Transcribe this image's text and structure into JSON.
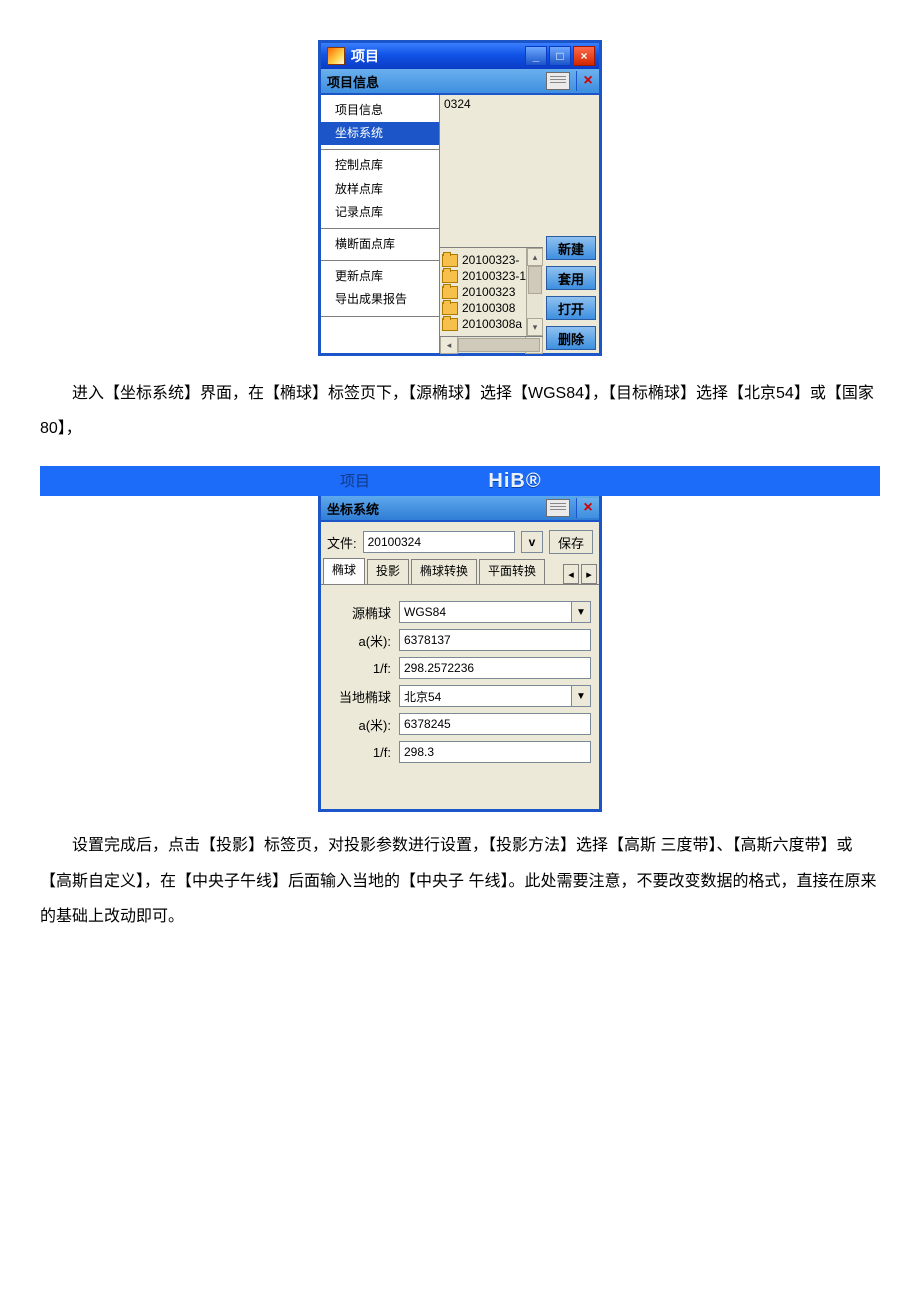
{
  "win1": {
    "title": "项目",
    "subheader": "项目信息",
    "menu": {
      "g1": [
        "项目信息",
        "坐标系统"
      ],
      "g2": [
        "控制点库",
        "放样点库",
        "记录点库"
      ],
      "g3": [
        "横断面点库"
      ],
      "g4": [
        "更新点库",
        "导出成果报告"
      ]
    },
    "top_right_text": "0324",
    "folders": [
      "20100323-",
      "20100323-1",
      "20100323",
      "20100308",
      "20100308a"
    ],
    "buttons": {
      "new": "新建",
      "apply": "套用",
      "open": "打开",
      "del": "删除"
    },
    "wbtn": {
      "min": "_",
      "max": "□",
      "close": "×"
    }
  },
  "para1": "进入【坐标系统】界面，在【椭球】标签页下，【源椭球】选择【WGS84】，【目标椭球】选择【北京54】或【国家80】，",
  "win2": {
    "bar_title": "项目",
    "brand": "HiB®",
    "subheader": "坐标系统",
    "file_label": "文件:",
    "file_value": "20100324",
    "save": "保存",
    "tabs": {
      "t1": "椭球",
      "t2": "投影",
      "t3": "椭球转换",
      "t4": "平面转换"
    },
    "fields": {
      "src_label": "源椭球",
      "src_value": "WGS84",
      "a1_label": "a(米):",
      "a1_value": "6378137",
      "f1_label": "1/f:",
      "f1_value": "298.2572236",
      "tgt_label": "当地椭球",
      "tgt_value": "北京54",
      "a2_label": "a(米):",
      "a2_value": "6378245",
      "f2_label": "1/f:",
      "f2_value": "298.3"
    }
  },
  "para2": "设置完成后，点击【投影】标签页，对投影参数进行设置，【投影方法】选择【高斯 三度带】、【高斯六度带】或【高斯自定义】，在【中央子午线】后面输入当地的【中央子 午线】。此处需要注意，不要改变数据的格式，直接在原来的基础上改动即可。"
}
